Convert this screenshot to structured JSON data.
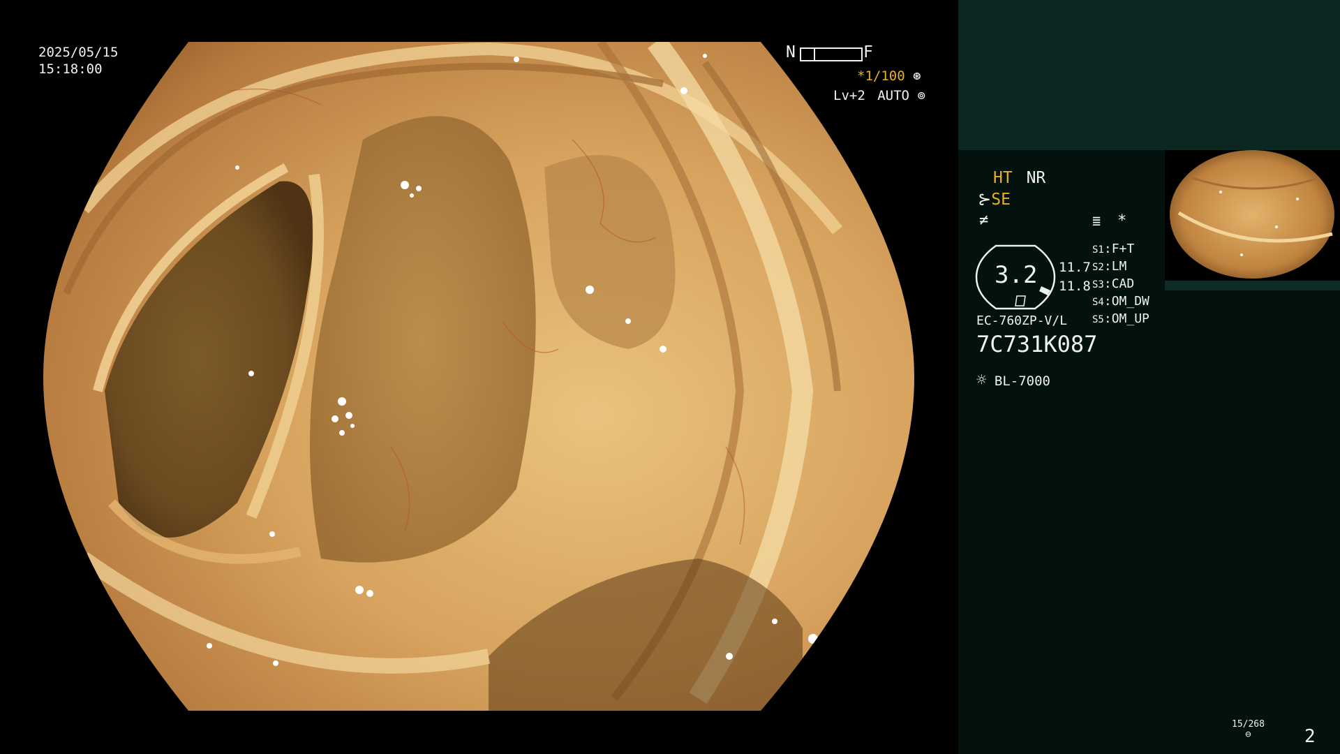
{
  "overlay": {
    "date": "2025/05/15",
    "time": "15:18:00",
    "focus_near": "N",
    "focus_far": "F",
    "shutter": "*1/100",
    "level": "Lv+2",
    "iris": "AUTO"
  },
  "panel": {
    "ht": "HT",
    "nr": "NR",
    "se": "SE",
    "dial_value": "3.2",
    "value_a": "11.7",
    "value_b": "11.8",
    "star": "*",
    "switches": [
      {
        "key": "S1",
        "value": "F+T"
      },
      {
        "key": "S2",
        "value": "LM"
      },
      {
        "key": "S3",
        "value": "CAD"
      },
      {
        "key": "S4",
        "value": "OM_DW"
      },
      {
        "key": "S5",
        "value": "OM_UP"
      }
    ],
    "scope_model": "EC-760ZP-V/L",
    "serial": "7C731K087",
    "light_source": "BL-7000",
    "counter": "15/268",
    "page": "2"
  },
  "colors": {
    "panel_bg": "#03110f",
    "panel_top_bg": "#0c2622",
    "accent_yellow": "#e8b020"
  }
}
